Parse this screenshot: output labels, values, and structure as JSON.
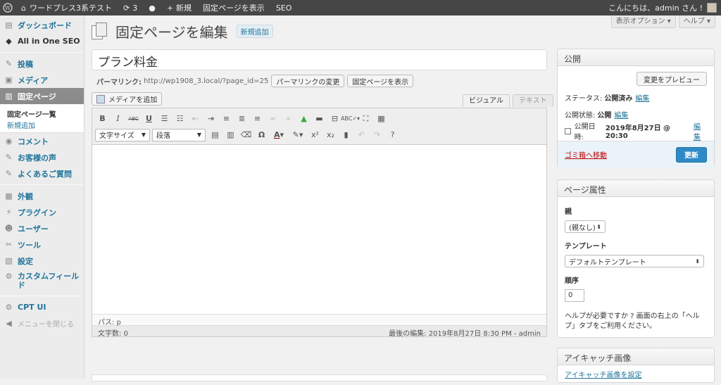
{
  "adminbar": {
    "site_name": "ワードプレス3系テスト",
    "updates_count": "3",
    "new_label": "新規",
    "view_page": "固定ページを表示",
    "seo": "SEO",
    "greeting": "こんにちは、admin さん !"
  },
  "screen_options": {
    "options": "表示オプション ▾",
    "help": "ヘルプ ▾"
  },
  "sidebar": {
    "dashboard": "ダッシュボード",
    "aioseo": "All in One SEO",
    "posts": "投稿",
    "media": "メディア",
    "pages": "固定ページ",
    "pages_sub": [
      "固定ページ一覧",
      "新規追加"
    ],
    "comments": "コメント",
    "testimonials": "お客様の声",
    "faq": "よくあるご質問",
    "appearance": "外観",
    "plugins": "プラグイン",
    "users": "ユーザー",
    "tools": "ツール",
    "settings": "設定",
    "custom_fields": "カスタムフィールド",
    "cpt_ui": "CPT UI",
    "collapse": "メニューを閉じる"
  },
  "page": {
    "title": "固定ページを編集",
    "add_new": "新規追加",
    "post_title": "プラン料金",
    "permalink_label": "パーマリンク:",
    "permalink_url": "http://wp1908_3.local/?page_id=25",
    "change_permalink": "パーマリンクの変更",
    "view_page": "固定ページを表示",
    "add_media": "メディアを追加"
  },
  "editor": {
    "tab_visual": "ビジュアル",
    "tab_text": "テキスト",
    "format_select": "文字サイズ",
    "paragraph_select": "段落",
    "path": "パス: p",
    "word_count": "文字数: 0",
    "last_edit": "最後の編集: 2019年8月27日 8:30 PM - admin"
  },
  "publish": {
    "title": "公開",
    "preview": "変更をプレビュー",
    "status_label": "ステータス:",
    "status_value": "公開済み",
    "visibility_label": "公開状態:",
    "visibility_value": "公開",
    "date_label": "公開日時:",
    "date_value": "2019年8月27日 @ 20:30",
    "edit": "編集",
    "trash": "ゴミ箱へ移動",
    "update": "更新"
  },
  "attributes": {
    "title": "ページ属性",
    "parent_label": "親",
    "parent_value": "(親なし)",
    "template_label": "テンプレート",
    "template_value": "デフォルトテンプレート",
    "order_label": "順序",
    "order_value": "0",
    "help": "ヘルプが必要ですか ? 画面の右上の「ヘルプ」タブをご利用ください。"
  },
  "featured": {
    "title": "アイキャッチ画像",
    "set_link": "アイキャッチ画像を設定"
  },
  "colors": {
    "adminbar": "#464646",
    "link": "#21759b",
    "primary_button": "#2e8ac6",
    "trash": "#bb0000"
  }
}
